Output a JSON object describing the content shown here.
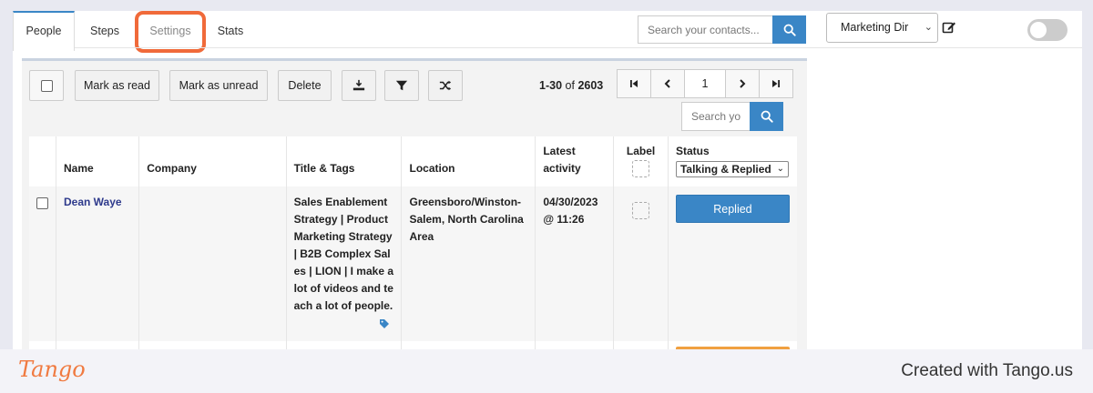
{
  "tabs": [
    {
      "label": "People"
    },
    {
      "label": "Steps"
    },
    {
      "label": "Settings"
    },
    {
      "label": "Stats"
    }
  ],
  "header": {
    "search_placeholder": "Search your contacts...",
    "campaign_select": "Marketing Dir",
    "toggle_on": false
  },
  "toolbar": {
    "mark_read": "Mark as read",
    "mark_unread": "Mark as unread",
    "delete": "Delete",
    "count_range": "1-30",
    "count_of": "of",
    "count_total": "2603",
    "page": "1",
    "search_placeholder": "Search your contacts..."
  },
  "table": {
    "columns": {
      "name": "Name",
      "company": "Company",
      "title_tags": "Title & Tags",
      "location": "Location",
      "latest_activity": "Latest activity",
      "label": "Label",
      "status": "Status"
    },
    "status_filter": "Talking & Replied",
    "rows": [
      {
        "name": "Dean Waye",
        "company": "",
        "title": "Sales Enablement Strategy | Product Marketing Strategy | B2B Complex Sales | LION | I make a lot of videos and teach a lot of people.",
        "location": "Greensboro/Winston-Salem, North Carolina Area",
        "latest_activity": "04/30/2023 @ 11:26",
        "status": "Replied"
      }
    ]
  },
  "footer": {
    "logo": "Tango",
    "credit": "Created with Tango.us"
  },
  "colors": {
    "accent": "#3a86c6",
    "highlight": "#f06a3a",
    "brand": "#f07a40"
  }
}
